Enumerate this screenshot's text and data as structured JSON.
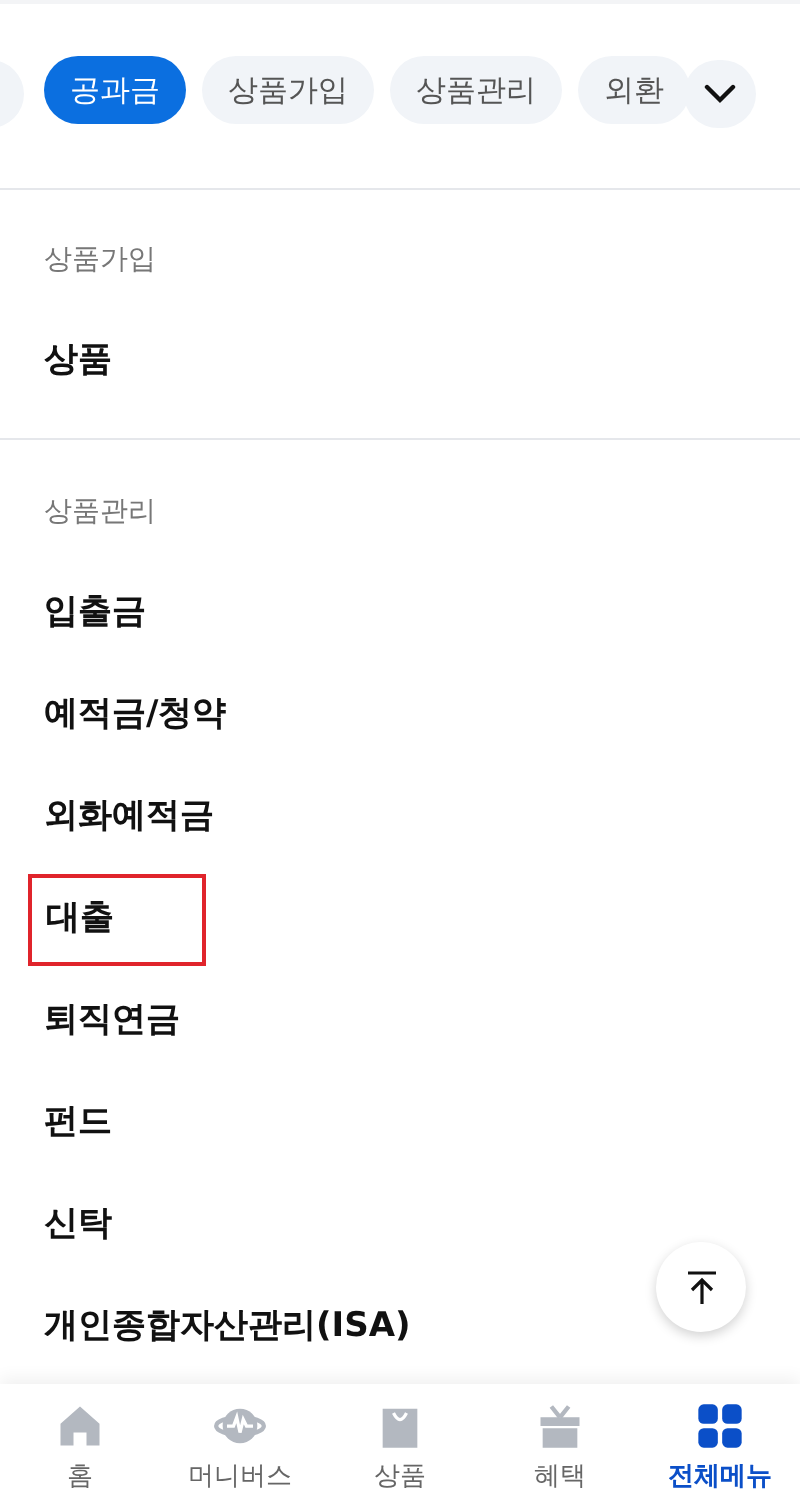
{
  "chips": [
    {
      "label": "공과금",
      "selected": true
    },
    {
      "label": "상품가입",
      "selected": false
    },
    {
      "label": "상품관리",
      "selected": false
    },
    {
      "label": "외환",
      "selected": false
    }
  ],
  "sections": [
    {
      "title": "상품가입",
      "items": [
        {
          "label": "상품",
          "highlighted": false
        }
      ]
    },
    {
      "title": "상품관리",
      "items": [
        {
          "label": "입출금",
          "highlighted": false
        },
        {
          "label": "예적금/청약",
          "highlighted": false
        },
        {
          "label": "외화예적금",
          "highlighted": false
        },
        {
          "label": "대출",
          "highlighted": true
        },
        {
          "label": "퇴직연금",
          "highlighted": false
        },
        {
          "label": "펀드",
          "highlighted": false
        },
        {
          "label": "신탁",
          "highlighted": false
        },
        {
          "label": "개인종합자산관리(ISA)",
          "highlighted": false
        }
      ]
    }
  ],
  "nav": [
    {
      "label": "홈",
      "selected": false
    },
    {
      "label": "머니버스",
      "selected": false
    },
    {
      "label": "상품",
      "selected": false
    },
    {
      "label": "혜택",
      "selected": false
    },
    {
      "label": "전체메뉴",
      "selected": true
    }
  ]
}
